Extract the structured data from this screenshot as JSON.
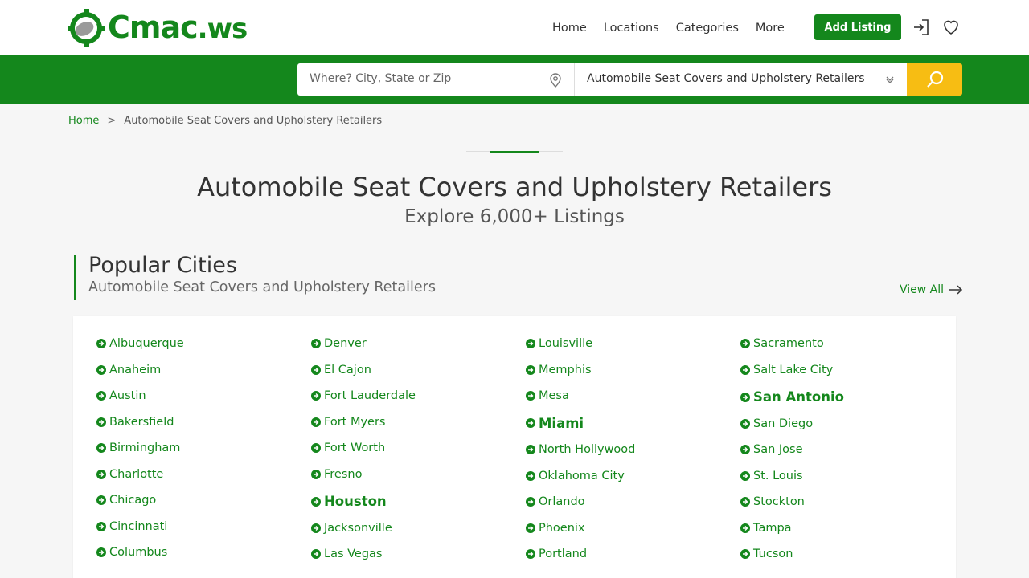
{
  "header": {
    "logo": {
      "main": "Cmac",
      "suffix": ".ws"
    },
    "nav": [
      "Home",
      "Locations",
      "Categories",
      "More"
    ],
    "add_listing": "Add Listing",
    "icons": [
      "login-icon",
      "heart-icon"
    ]
  },
  "search": {
    "where_placeholder": "Where? City, State or Zip",
    "category_value": "Automobile Seat Covers and Upholstery Retailers",
    "icons": [
      "map-pin-icon",
      "chevron-down-icon",
      "search-icon"
    ]
  },
  "breadcrumb": {
    "home": "Home",
    "separator": ">",
    "current": "Automobile Seat Covers and Upholstery Retailers"
  },
  "page": {
    "title": "Automobile Seat Covers and Upholstery Retailers",
    "subtitle": "Explore 6,000+ Listings"
  },
  "popular": {
    "title": "Popular Cities",
    "subtitle": "Automobile Seat Covers and Upholstery Retailers",
    "view_all": "View All",
    "columns": [
      [
        {
          "name": "Albuquerque"
        },
        {
          "name": "Anaheim"
        },
        {
          "name": "Austin"
        },
        {
          "name": "Bakersfield"
        },
        {
          "name": "Birmingham"
        },
        {
          "name": "Charlotte"
        },
        {
          "name": "Chicago"
        },
        {
          "name": "Cincinnati"
        },
        {
          "name": "Columbus"
        }
      ],
      [
        {
          "name": "Denver"
        },
        {
          "name": "El Cajon"
        },
        {
          "name": "Fort Lauderdale"
        },
        {
          "name": "Fort Myers"
        },
        {
          "name": "Fort Worth"
        },
        {
          "name": "Fresno"
        },
        {
          "name": "Houston",
          "bold": true
        },
        {
          "name": "Jacksonville"
        },
        {
          "name": "Las Vegas"
        }
      ],
      [
        {
          "name": "Louisville"
        },
        {
          "name": "Memphis"
        },
        {
          "name": "Mesa"
        },
        {
          "name": "Miami",
          "bold": true
        },
        {
          "name": "North Hollywood"
        },
        {
          "name": "Oklahoma City"
        },
        {
          "name": "Orlando"
        },
        {
          "name": "Phoenix"
        },
        {
          "name": "Portland"
        }
      ],
      [
        {
          "name": "Sacramento"
        },
        {
          "name": "Salt Lake City"
        },
        {
          "name": "San Antonio",
          "bold": true
        },
        {
          "name": "San Diego"
        },
        {
          "name": "San Jose"
        },
        {
          "name": "St. Louis"
        },
        {
          "name": "Stockton"
        },
        {
          "name": "Tampa"
        },
        {
          "name": "Tucson"
        }
      ]
    ]
  },
  "colors": {
    "brand_green": "#14871c",
    "search_yellow": "#f7bd13",
    "background": "#f6f6f6"
  }
}
